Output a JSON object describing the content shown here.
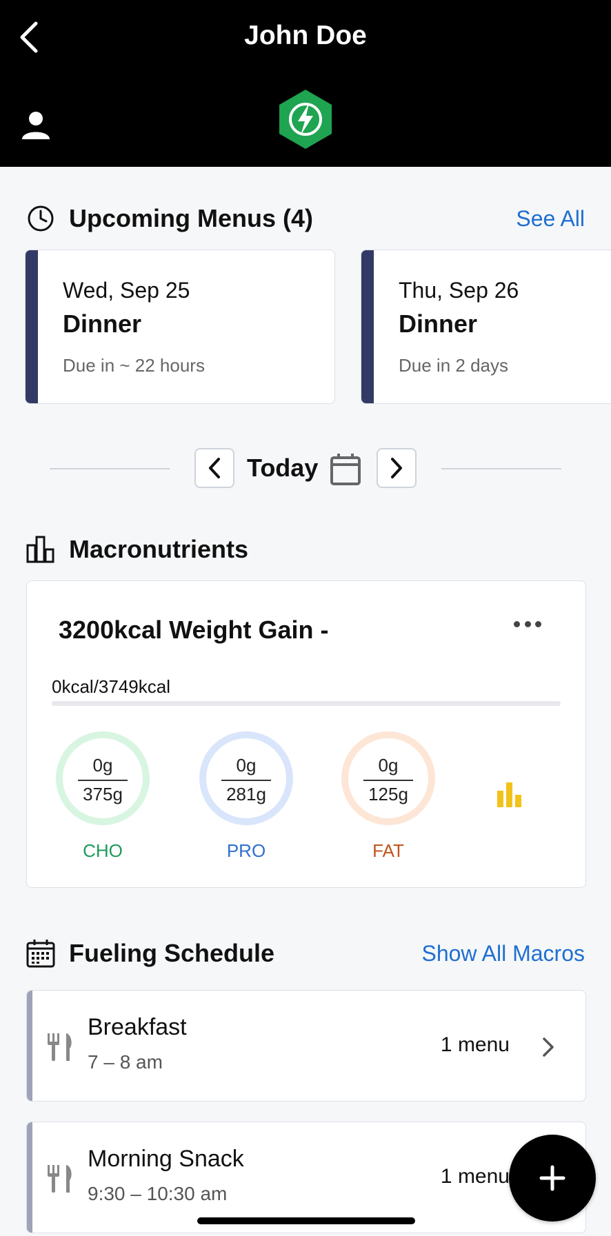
{
  "header": {
    "title": "John Doe"
  },
  "upcoming": {
    "title": "Upcoming Menus (4)",
    "see_all": "See All",
    "cards": [
      {
        "date": "Wed, Sep 25",
        "meal": "Dinner",
        "due": "Due in ~ 22 hours"
      },
      {
        "date": "Thu, Sep 26",
        "meal": "Dinner",
        "due": "Due in 2 days"
      }
    ]
  },
  "daynav": {
    "label": "Today"
  },
  "macros": {
    "title": "Macronutrients",
    "plan_name": "3200kcal Weight Gain -",
    "kcal_text": "0kcal/3749kcal",
    "kcal_progress": 0,
    "rings": [
      {
        "label": "CHO",
        "current": "0g",
        "target": "375g",
        "color": "#1e9a5a",
        "ring_color": "#d8f5e2"
      },
      {
        "label": "PRO",
        "current": "0g",
        "target": "281g",
        "color": "#2f6fd0",
        "ring_color": "#d9e5fb"
      },
      {
        "label": "FAT",
        "current": "0g",
        "target": "125g",
        "color": "#c2541c",
        "ring_color": "#fde6d6"
      }
    ]
  },
  "schedule": {
    "title": "Fueling Schedule",
    "show_all": "Show All Macros",
    "items": [
      {
        "meal": "Breakfast",
        "time": "7 – 8 am",
        "count": "1 menu"
      },
      {
        "meal": "Morning Snack",
        "time": "9:30 – 10:30 am",
        "count": "1 menu"
      }
    ]
  },
  "colors": {
    "accent_link": "#1f6fd1",
    "menu_bar": "#343a66",
    "logo_green": "#1fa451"
  }
}
